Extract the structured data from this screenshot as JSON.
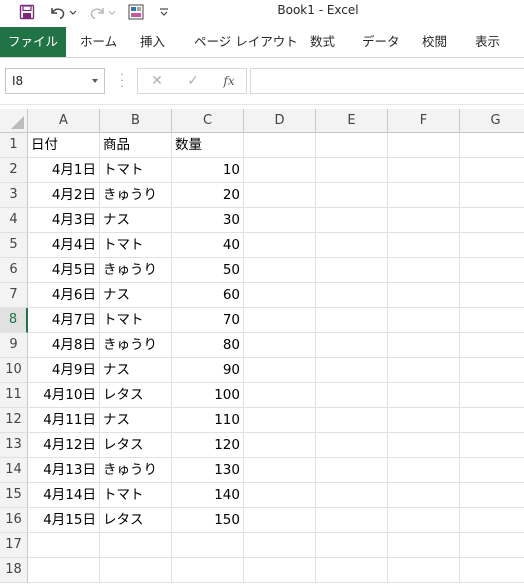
{
  "window": {
    "title": "Book1  -  Excel",
    "quick_access": [
      {
        "icon": "save-icon"
      },
      {
        "icon": "undo-icon"
      },
      {
        "icon": "redo-icon"
      },
      {
        "icon": "form-icon"
      },
      {
        "icon": "customize-qat-icon"
      }
    ]
  },
  "ribbon": {
    "tabs": [
      "ファイル",
      "ホーム",
      "挿入",
      "ページ レイアウト",
      "数式",
      "データ",
      "校閲",
      "表示"
    ]
  },
  "formula_bar": {
    "name_box": "I8",
    "cancel_icon": "✕",
    "enter_icon": "✓",
    "fx_label": "fx",
    "formula": ""
  },
  "sheet": {
    "columns": [
      "A",
      "B",
      "C",
      "D",
      "E",
      "F",
      "G"
    ],
    "selected_row": 8,
    "rows": [
      {
        "n": "1",
        "a": "日付",
        "b": "商品",
        "c": "数量"
      },
      {
        "n": "2",
        "a": "4月1日",
        "b": "トマト",
        "c": "10"
      },
      {
        "n": "3",
        "a": "4月2日",
        "b": "きゅうり",
        "c": "20"
      },
      {
        "n": "4",
        "a": "4月3日",
        "b": "ナス",
        "c": "30"
      },
      {
        "n": "5",
        "a": "4月4日",
        "b": "トマト",
        "c": "40"
      },
      {
        "n": "6",
        "a": "4月5日",
        "b": "きゅうり",
        "c": "50"
      },
      {
        "n": "7",
        "a": "4月6日",
        "b": "ナス",
        "c": "60"
      },
      {
        "n": "8",
        "a": "4月7日",
        "b": "トマト",
        "c": "70"
      },
      {
        "n": "9",
        "a": "4月8日",
        "b": "きゅうり",
        "c": "80"
      },
      {
        "n": "10",
        "a": "4月9日",
        "b": "ナス",
        "c": "90"
      },
      {
        "n": "11",
        "a": "4月10日",
        "b": "レタス",
        "c": "100"
      },
      {
        "n": "12",
        "a": "4月11日",
        "b": "ナス",
        "c": "110"
      },
      {
        "n": "13",
        "a": "4月12日",
        "b": "レタス",
        "c": "120"
      },
      {
        "n": "14",
        "a": "4月13日",
        "b": "きゅうり",
        "c": "130"
      },
      {
        "n": "15",
        "a": "4月14日",
        "b": "トマト",
        "c": "140"
      },
      {
        "n": "16",
        "a": "4月15日",
        "b": "レタス",
        "c": "150"
      },
      {
        "n": "17",
        "a": "",
        "b": "",
        "c": ""
      },
      {
        "n": "18",
        "a": "",
        "b": "",
        "c": ""
      }
    ]
  },
  "colors": {
    "accent": "#217346",
    "header_bg": "#f3f3f3",
    "gridline": "#e1e1e1"
  }
}
